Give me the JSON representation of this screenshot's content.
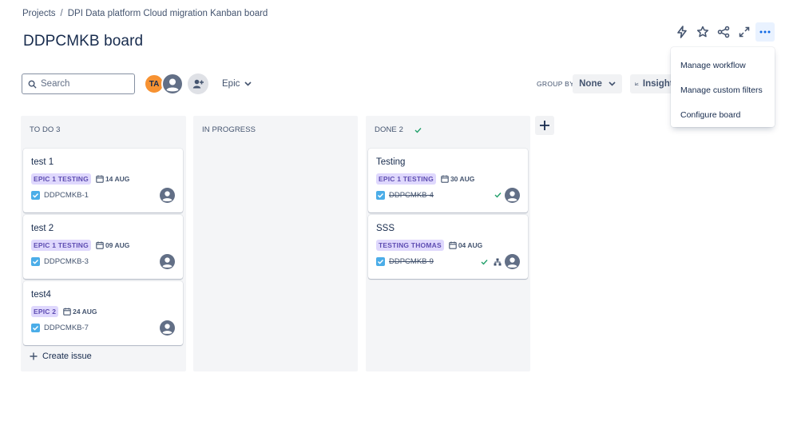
{
  "breadcrumb": {
    "root": "Projects",
    "separator": "/",
    "project": "DPI Data platform Cloud migration Kanban board"
  },
  "page_title": "DDPCMKB board",
  "top_actions": [
    "lightning-icon",
    "star-icon",
    "share-icon",
    "expand-icon",
    "more-icon"
  ],
  "toolbar": {
    "search_placeholder": "Search",
    "avatar_initials": "TA",
    "epic_label": "Epic",
    "groupby_label": "GROUP BY",
    "groupby_value": "None",
    "insights_label": "Insights"
  },
  "menu": {
    "items": [
      "Manage workflow",
      "Manage custom filters",
      "Configure board"
    ]
  },
  "columns": {
    "todo": {
      "title": "TO DO 3",
      "cards": [
        {
          "title": "test 1",
          "epic": "EPIC 1 TESTING",
          "date": "14 AUG",
          "key": "DDPCMKB-1"
        },
        {
          "title": "test 2",
          "epic": "EPIC 1 TESTING",
          "date": "09 AUG",
          "key": "DDPCMKB-3"
        },
        {
          "title": "test4",
          "epic": "EPIC 2",
          "date": "24 AUG",
          "key": "DDPCMKB-7"
        }
      ],
      "create_label": "Create issue"
    },
    "progress": {
      "title": "IN PROGRESS"
    },
    "done": {
      "title": "DONE 2",
      "cards": [
        {
          "title": "Testing",
          "epic": "EPIC 1 TESTING",
          "date": "30 AUG",
          "key": "DDPCMKB-4"
        },
        {
          "title": "SSS",
          "epic": "TESTING THOMAS",
          "date": "04 AUG",
          "key": "DDPCMKB-9"
        }
      ]
    }
  },
  "colors": {
    "accent": "#0c66e4",
    "lozenge_bg": "#dfd8fd",
    "lozenge_text": "#5e4db2",
    "column_bg": "#f4f5f7",
    "done_check": "#22a06b",
    "avatar_ta": "#f79232"
  }
}
